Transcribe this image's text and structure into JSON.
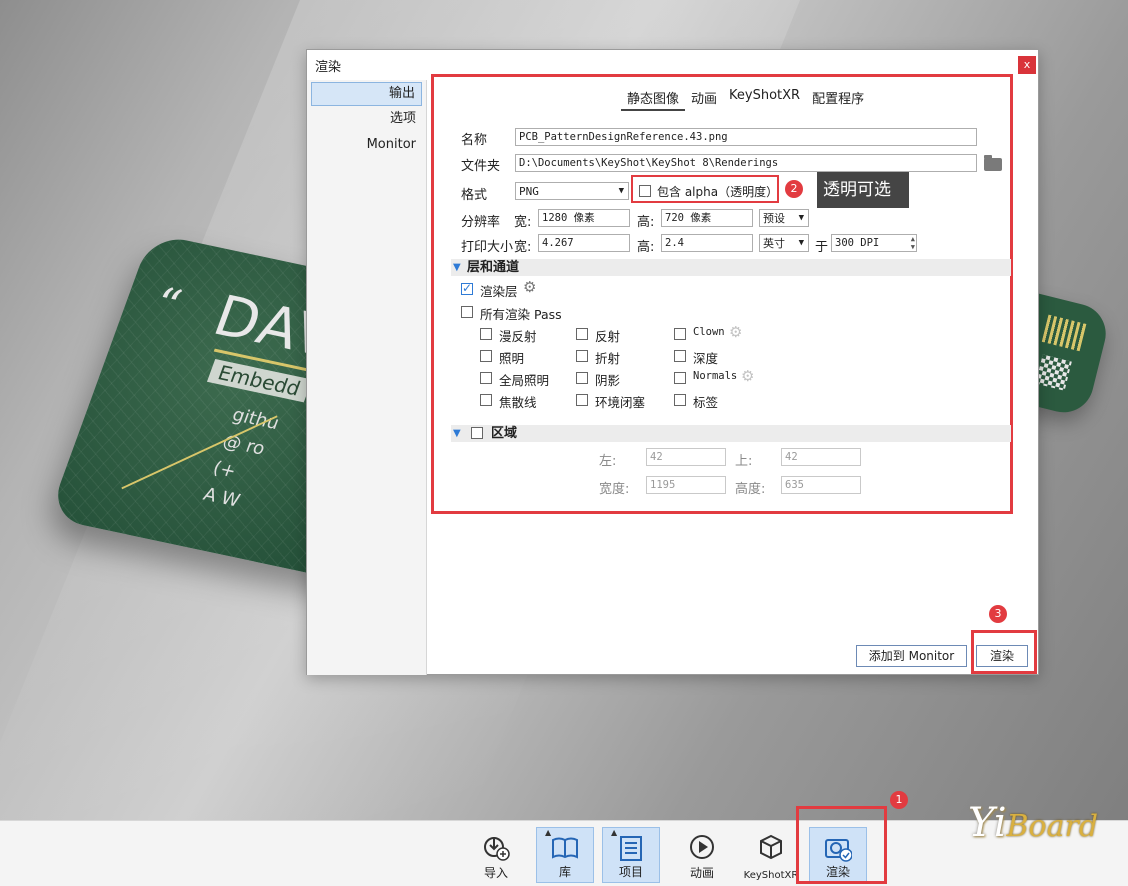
{
  "dialog": {
    "title": "渲染",
    "close": "x",
    "sidebar": [
      "输出",
      "选项",
      "Monitor"
    ],
    "tabs": [
      "静态图像",
      "动画",
      "KeyShotXR",
      "配置程序"
    ],
    "form": {
      "name_label": "名称",
      "name_value": "PCB_PatternDesignReference.43.png",
      "folder_label": "文件夹",
      "folder_value": "D:\\Documents\\KeyShot\\KeyShot 8\\Renderings",
      "format_label": "格式",
      "format_value": "PNG",
      "alpha_label": "包含 alpha（透明度）",
      "resolution_label": "分辨率",
      "width_label": "宽:",
      "width_value": "1280 像素",
      "height_label": "高:",
      "height_value": "720 像素",
      "preset_value": "预设",
      "print_label": "打印大小",
      "print_width_label": "宽:",
      "print_width_value": "4.267",
      "print_height_label": "高:",
      "print_height_value": "2.4",
      "unit_value": "英寸",
      "at_label": "于",
      "dpi_value": "300 DPI"
    },
    "layers": {
      "section_title": "层和通道",
      "render_layers": "渲染层",
      "all_passes": "所有渲染 Pass",
      "passes": [
        "漫反射",
        "反射",
        "Clown",
        "照明",
        "折射",
        "深度",
        "全局照明",
        "阴影",
        "Normals",
        "焦散线",
        "环境闭塞",
        "标签"
      ]
    },
    "region": {
      "section_title": "区域",
      "left_label": "左:",
      "left_value": "42",
      "top_label": "上:",
      "top_value": "42",
      "width_label": "宽度:",
      "width_value": "1195",
      "height_label": "高度:",
      "height_value": "635"
    },
    "buttons": {
      "add_monitor": "添加到 Monitor",
      "render": "渲染"
    }
  },
  "annotations": {
    "badge1": "1",
    "badge2": "2",
    "badge3": "3",
    "tooltip": "透明可选"
  },
  "toolbar": [
    "导入",
    "库",
    "项目",
    "动画",
    "KeyShotXR",
    "渲染"
  ],
  "watermark": {
    "main": "Yi",
    "sub": "Board"
  },
  "pcb": {
    "title": "DAV",
    "subtitle": "Embedd",
    "line1": "githu",
    "line2": "@ ro",
    "line3": "(+",
    "line4": "A W"
  }
}
